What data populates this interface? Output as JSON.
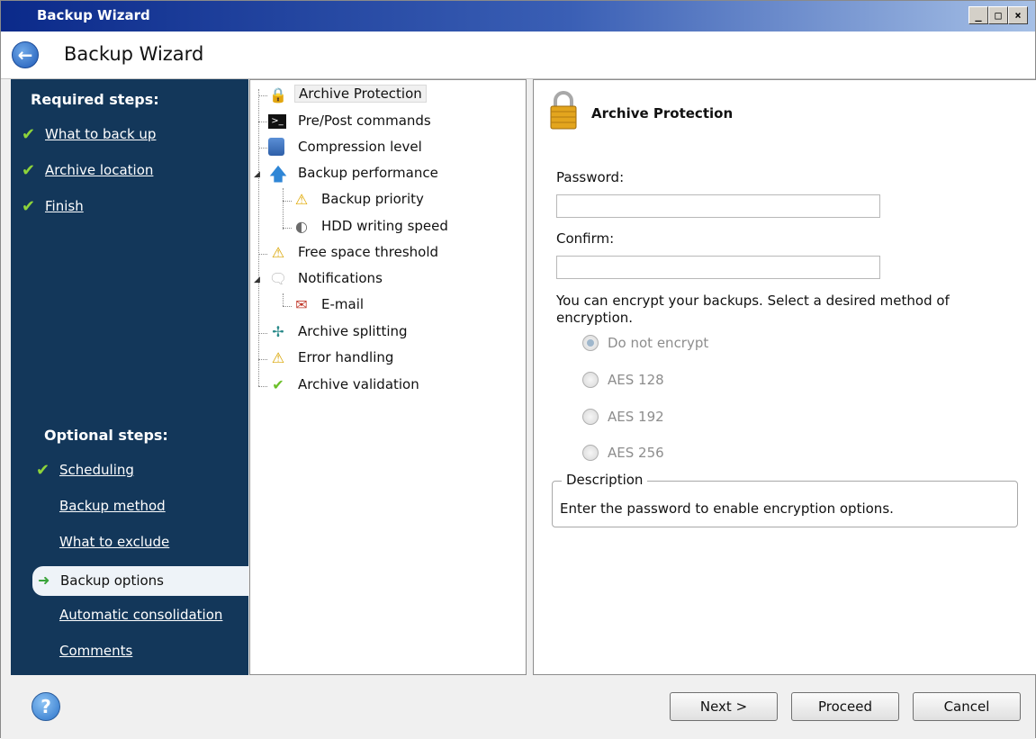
{
  "window": {
    "title": "Backup Wizard",
    "controls": [
      "_",
      "□",
      "×"
    ]
  },
  "header": {
    "title": "Backup Wizard",
    "back_icon": "back-arrow-icon"
  },
  "sidebar": {
    "required_heading": "Required steps:",
    "required_items": [
      {
        "label": "What to back up",
        "checked": true
      },
      {
        "label": "Archive location",
        "checked": true
      },
      {
        "label": "Finish",
        "checked": true
      }
    ],
    "optional_heading": "Optional steps:",
    "optional_items": [
      {
        "label": "Scheduling",
        "checked": true
      },
      {
        "label": "Backup method",
        "checked": false
      },
      {
        "label": "What to exclude",
        "checked": false
      },
      {
        "label": "Backup options",
        "checked": false,
        "active": true
      },
      {
        "label": "Automatic consolidation",
        "checked": false
      },
      {
        "label": "Comments",
        "checked": false
      }
    ]
  },
  "tree": {
    "items": [
      {
        "label": "Archive Protection",
        "icon": "lock-icon",
        "selected": true
      },
      {
        "label": "Pre/Post commands",
        "icon": "terminal-icon"
      },
      {
        "label": "Compression level",
        "icon": "compression-icon"
      },
      {
        "label": "Backup performance",
        "icon": "up-arrow-icon",
        "expanded": true
      },
      {
        "label": "Backup priority",
        "icon": "priority-icon"
      },
      {
        "label": "HDD writing speed",
        "icon": "speedometer-icon"
      },
      {
        "label": "Free space threshold",
        "icon": "warning-icon"
      },
      {
        "label": "Notifications",
        "icon": "speech-bubble-icon",
        "expanded": true
      },
      {
        "label": "E-mail",
        "icon": "email-icon"
      },
      {
        "label": "Archive splitting",
        "icon": "split-icon"
      },
      {
        "label": "Error handling",
        "icon": "warning-icon"
      },
      {
        "label": "Archive validation",
        "icon": "checkmark-icon"
      }
    ]
  },
  "content": {
    "title": "Archive Protection",
    "password_label": "Password:",
    "password_value": "",
    "confirm_label": "Confirm:",
    "confirm_value": "",
    "encrypt_text": "You can encrypt your backups. Select a desired method of encryption.",
    "options": [
      {
        "label": "Do not encrypt",
        "checked": true
      },
      {
        "label": "AES 128",
        "checked": false
      },
      {
        "label": "AES 192",
        "checked": false
      },
      {
        "label": "AES 256",
        "checked": false
      }
    ],
    "description_legend": "Description",
    "description_text": "Enter the password to enable encryption options."
  },
  "footer": {
    "next_label": "Next >",
    "proceed_label": "Proceed",
    "cancel_label": "Cancel"
  },
  "colors": {
    "sidebar_bg": "#13375a",
    "check_green": "#8ed43a",
    "title_gradient_start": "#0b2a8a"
  }
}
